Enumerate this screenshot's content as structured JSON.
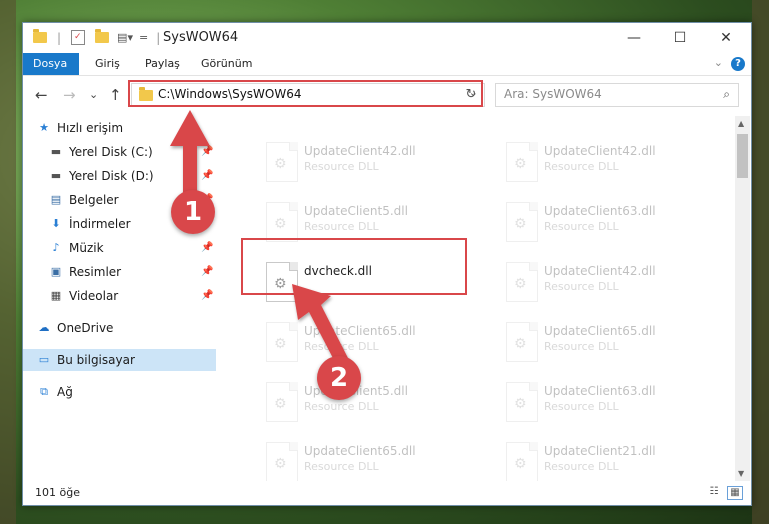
{
  "window": {
    "title": "SysWOW64",
    "qa_separator": "|",
    "qa_customize": "=",
    "minimize": "—",
    "maximize": "☐",
    "close": "✕"
  },
  "ribbon": {
    "tabs": [
      {
        "label": "Dosya"
      },
      {
        "label": "Giriş"
      },
      {
        "label": "Paylaş"
      },
      {
        "label": "Görünüm"
      }
    ],
    "expand_glyph": "⌄",
    "help": "?"
  },
  "nav": {
    "back": "←",
    "forward": "→",
    "recent": "⌄",
    "up": "↑",
    "address": "C:\\Windows\\SysWOW64",
    "address_dropdown": "⌄",
    "refresh": "↻",
    "search_placeholder": "Ara: SysWOW64",
    "search_icon": "⌕"
  },
  "sidebar": {
    "items": [
      {
        "label": "Hızlı erişim",
        "icon": "star-icon",
        "glyph": "★",
        "color": "#2a7fd4",
        "pinned": false
      },
      {
        "label": "Yerel Disk (C:)",
        "icon": "drive-icon",
        "glyph": "▬",
        "color": "#555555",
        "pinned": true
      },
      {
        "label": "Yerel Disk (D:)",
        "icon": "drive-icon",
        "glyph": "▬",
        "color": "#555555",
        "pinned": true
      },
      {
        "label": "Belgeler",
        "icon": "documents-icon",
        "glyph": "▤",
        "color": "#3a6ea5",
        "pinned": true
      },
      {
        "label": "İndirmeler",
        "icon": "download-icon",
        "glyph": "⬇",
        "color": "#2a7fd4",
        "pinned": true
      },
      {
        "label": "Müzik",
        "icon": "music-icon",
        "glyph": "♪",
        "color": "#2a7fd4",
        "pinned": true
      },
      {
        "label": "Resimler",
        "icon": "pictures-icon",
        "glyph": "▣",
        "color": "#3a6ea5",
        "pinned": true
      },
      {
        "label": "Videolar",
        "icon": "video-icon",
        "glyph": "▦",
        "color": "#444444",
        "pinned": true
      },
      {
        "label": "OneDrive",
        "icon": "cloud-icon",
        "glyph": "☁",
        "color": "#1f6fc4",
        "pinned": false
      },
      {
        "label": "Bu bilgisayar",
        "icon": "computer-icon",
        "glyph": "▭",
        "color": "#2a7fd4",
        "pinned": false,
        "selected": true
      },
      {
        "label": "Ağ",
        "icon": "network-icon",
        "glyph": "⧉",
        "color": "#2a7fd4",
        "pinned": false
      }
    ],
    "pin_glyph": "📌"
  },
  "files": [
    {
      "name": "UpdateClient42.dll",
      "type": "Resource DLL",
      "faded": true
    },
    {
      "name": "UpdateClient42.dll",
      "type": "Resource DLL",
      "faded": true
    },
    {
      "name": "UpdateClient5.dll",
      "type": "Resource DLL",
      "faded": true
    },
    {
      "name": "UpdateClient63.dll",
      "type": "Resource DLL",
      "faded": true
    },
    {
      "name": "dvcheck.dll",
      "type": "",
      "faded": false
    },
    {
      "name": "UpdateClient42.dll",
      "type": "Resource DLL",
      "faded": true
    },
    {
      "name": "UpdateClient65.dll",
      "type": "Resource DLL",
      "faded": true
    },
    {
      "name": "UpdateClient65.dll",
      "type": "Resource DLL",
      "faded": true
    },
    {
      "name": "UpdateClient5.dll",
      "type": "Resource DLL",
      "faded": true
    },
    {
      "name": "UpdateClient63.dll",
      "type": "Resource DLL",
      "faded": true
    },
    {
      "name": "UpdateClient65.dll",
      "type": "Resource DLL",
      "faded": true
    },
    {
      "name": "UpdateClient21.dll",
      "type": "Resource DLL",
      "faded": true
    }
  ],
  "status": {
    "count": "101 öğe",
    "details_view": "☷",
    "tiles_view": "▦"
  },
  "annotations": {
    "marker1": "1",
    "marker2": "2",
    "color": "#d9474a"
  },
  "scrollbar": {
    "up": "▲",
    "down": "▼"
  }
}
